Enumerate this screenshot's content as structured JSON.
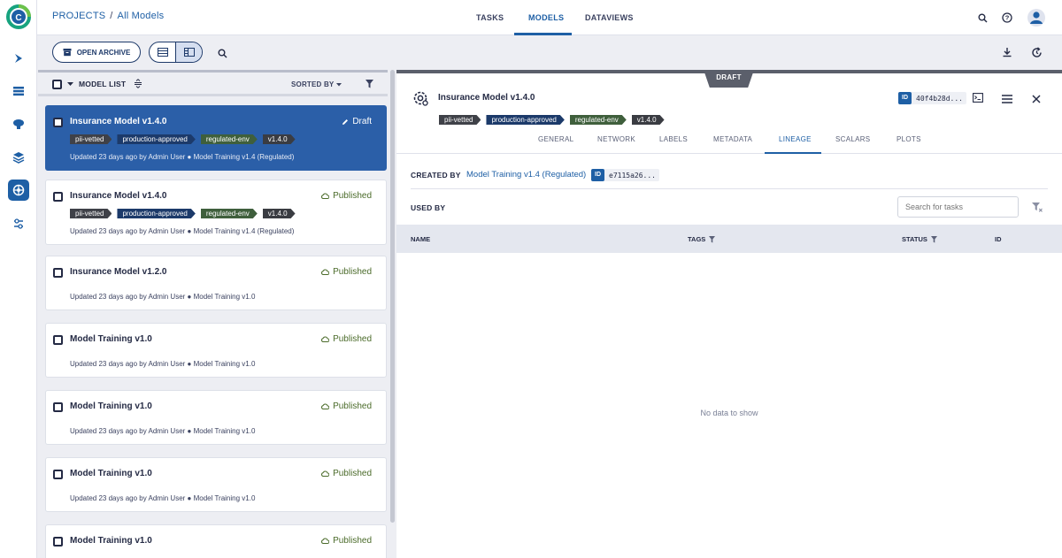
{
  "breadcrumb": {
    "root": "PROJECTS",
    "separator": "/",
    "current": "All Models"
  },
  "nav_tabs": [
    {
      "label": "TASKS"
    },
    {
      "label": "MODELS"
    },
    {
      "label": "DATAVIEWS"
    }
  ],
  "toolbar": {
    "open_archive_label": "OPEN ARCHIVE"
  },
  "list": {
    "header_label": "MODEL LIST",
    "sort_label": "SORTED BY",
    "cards": [
      {
        "name": "Insurance Model v1.4.0",
        "status": "Draft",
        "selected": true,
        "tags": [
          "pii-vetted",
          "production-approved",
          "regulated-env",
          "v1.4.0"
        ],
        "meta": "Updated 23 days ago by Admin User  ●  Model Training v1.4 (Regulated)"
      },
      {
        "name": "Insurance Model v1.4.0",
        "status": "Published",
        "selected": false,
        "tags": [
          "pii-vetted",
          "production-approved",
          "regulated-env",
          "v1.4.0"
        ],
        "meta": "Updated 23 days ago by Admin User  ●  Model Training v1.4 (Regulated)"
      },
      {
        "name": "Insurance Model v1.2.0",
        "status": "Published",
        "selected": false,
        "tags": [],
        "meta": "Updated 23 days ago by Admin User  ●  Model Training v1.0"
      },
      {
        "name": "Model Training v1.0",
        "status": "Published",
        "selected": false,
        "tags": [],
        "meta": "Updated 23 days ago by Admin User  ●  Model Training v1.0"
      },
      {
        "name": "Model Training v1.0",
        "status": "Published",
        "selected": false,
        "tags": [],
        "meta": "Updated 23 days ago by Admin User  ●  Model Training v1.0"
      },
      {
        "name": "Model Training v1.0",
        "status": "Published",
        "selected": false,
        "tags": [],
        "meta": "Updated 23 days ago by Admin User  ●  Model Training v1.0"
      },
      {
        "name": "Model Training v1.0",
        "status": "Published",
        "selected": false,
        "tags": [],
        "meta": ""
      }
    ]
  },
  "tag_colors": {
    "pii-vetted": "#3f4148",
    "production-approved": "#1c3a6a",
    "regulated-env": "#3f5f3c",
    "v1.4.0": "#3a3c42"
  },
  "detail": {
    "badge": "DRAFT",
    "title": "Insurance Model v1.4.0",
    "id_label": "ID",
    "id_value": "40f4b28d...",
    "tags": [
      "pii-vetted",
      "production-approved",
      "regulated-env",
      "v1.4.0"
    ],
    "tabs": [
      "GENERAL",
      "NETWORK",
      "LABELS",
      "METADATA",
      "LINEAGE",
      "SCALARS",
      "PLOTS"
    ],
    "active_tab": "LINEAGE",
    "created_by_label": "CREATED BY",
    "created_by_link": "Model Training v1.4 (Regulated)",
    "created_by_id": "e7115a26...",
    "used_by_label": "USED BY",
    "search_placeholder": "Search for tasks",
    "columns": [
      "NAME",
      "TAGS",
      "STATUS",
      "ID"
    ],
    "empty_text": "No data to show"
  }
}
